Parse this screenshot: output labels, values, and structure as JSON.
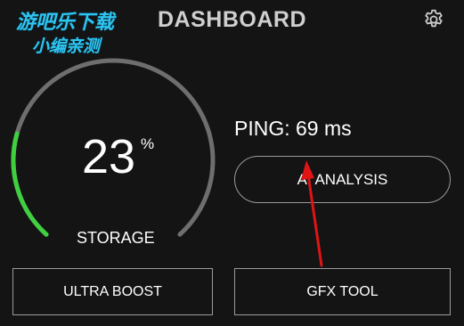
{
  "header": {
    "title": "DASHBOARD",
    "settings_icon": "gear-icon"
  },
  "watermark": {
    "line1": "游吧乐下载",
    "line2": "小编亲测",
    "color": "#2ec5f0"
  },
  "gauge": {
    "value": "23",
    "unit": "%",
    "label": "STORAGE",
    "fraction": 0.23,
    "track_color": "#6e6e6e",
    "fill_color": "#3fcf3f"
  },
  "ping": {
    "label": "PING:",
    "value": "69",
    "unit": "ms"
  },
  "buttons": {
    "analysis": "AI ANALYSIS",
    "ultra_boost": "ULTRA BOOST",
    "gfx_tool": "GFX TOOL"
  },
  "annotation": {
    "arrow_color": "#e01414"
  },
  "colors": {
    "background": "#141414",
    "border": "#9a9a9a",
    "title": "#cfcfcf"
  }
}
